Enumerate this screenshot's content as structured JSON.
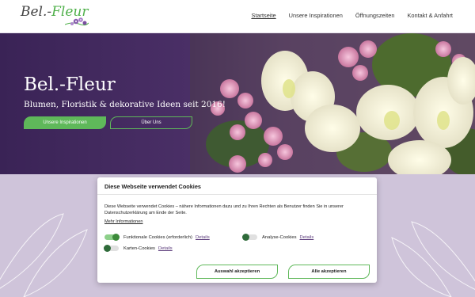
{
  "header": {
    "logo": {
      "part1": "Bel.-",
      "part2": "Fleur"
    },
    "nav": [
      {
        "label": "Startseite",
        "active": true
      },
      {
        "label": "Unsere Inspirationen"
      },
      {
        "label": "Öffnungszeiten"
      },
      {
        "label": "Kontakt & Anfahrt"
      }
    ]
  },
  "hero": {
    "title": "Bel.-Fleur",
    "subtitle": "Blumen, Floristik & dekorative Ideen seit 2016!",
    "primary_button": "Unsere Inspirationen",
    "secondary_button": "Über Uns"
  },
  "cookie": {
    "title": "Diese Webseite verwendet Cookies",
    "text": "Diese Webseite verwendet Cookies – nähere Informationen dazu und zu Ihren Rechten als Benutzer finden Sie in unserer Datenschutzerklärung am Ende der Seite.",
    "more_link": "Mehr Informationen",
    "options": [
      {
        "label": "Funktionale Cookies (erforderlich)",
        "details": "Details",
        "enabled": true
      },
      {
        "label": "Analyse-Cookies",
        "details": "Details",
        "enabled": false
      },
      {
        "label": "Karten-Cookies",
        "details": "Details",
        "enabled": false
      }
    ],
    "accept_selection": "Auswahl akzeptieren",
    "accept_all": "Alle akzeptieren"
  },
  "colors": {
    "accent_green": "#5fb85a",
    "hero_purple": "#3a2356",
    "lower_lilac": "#cfc4da"
  }
}
